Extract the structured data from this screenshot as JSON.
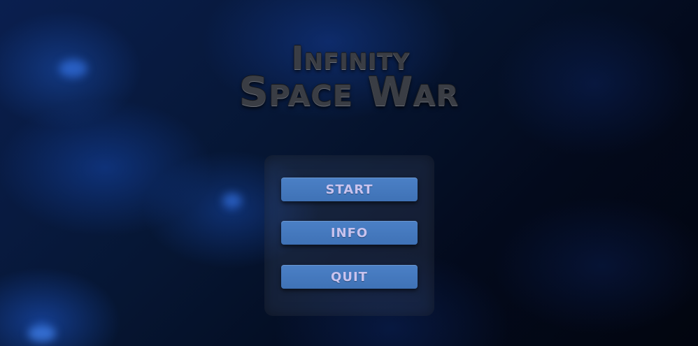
{
  "title": {
    "line1": "Infinity",
    "line2": "Space War"
  },
  "menu": {
    "start_label": "START",
    "info_label": "INFO",
    "quit_label": "QUIT"
  },
  "colors": {
    "button_fill": "#4577bc",
    "button_text": "#c9c3ee",
    "title_text": "#3a3d44",
    "background_deep": "#030a1c",
    "nebula_blue": "#1e55b4"
  }
}
